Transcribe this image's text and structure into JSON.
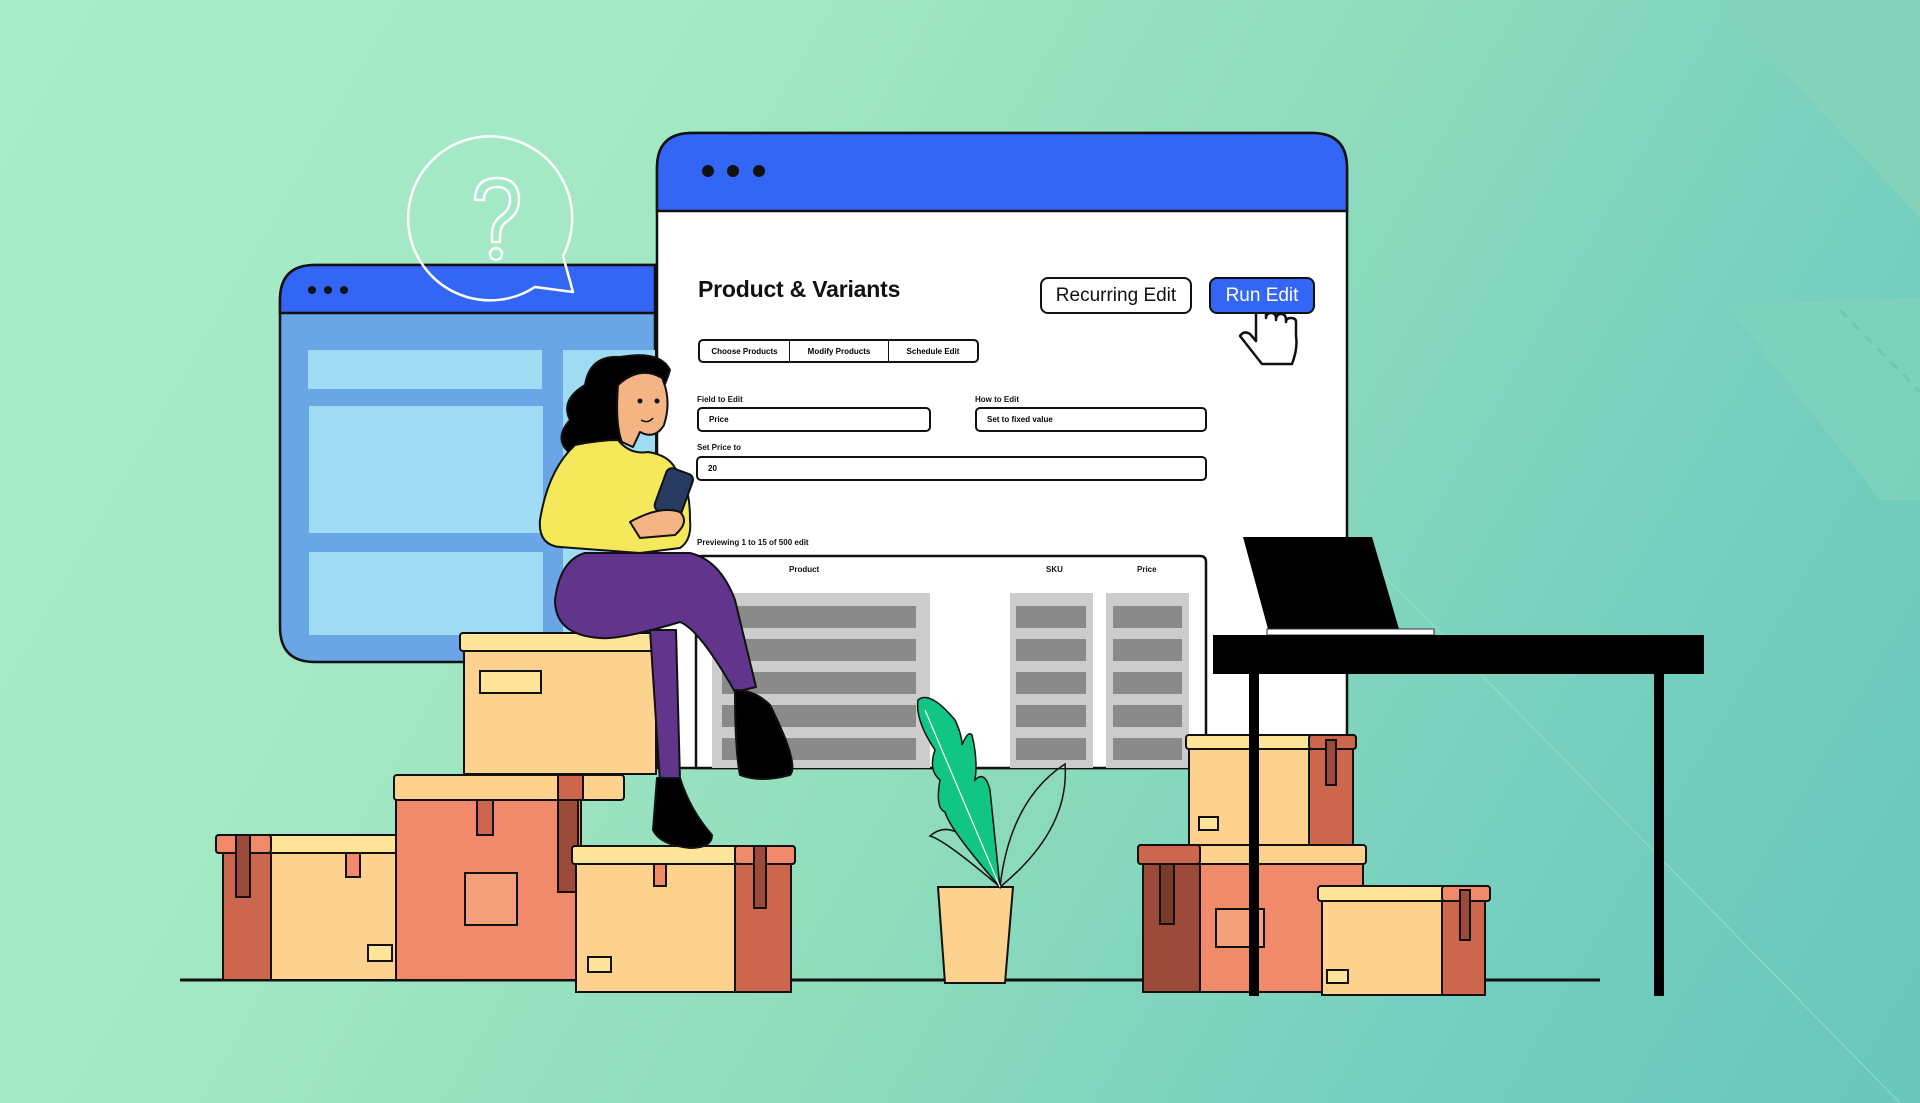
{
  "scene": {
    "description": "Illustration of a woman with a phone sitting on cardboard boxes in front of a bulk product editor window",
    "colors": {
      "accent_blue": "#3366f5",
      "left_window_body": "#6aa6e6",
      "left_window_panel": "#a0dbf4",
      "skeleton_light": "#cccccc",
      "skeleton_dark": "#8a8a8a",
      "box_light": "#fdd28e",
      "box_lid_light": "#fee59a",
      "box_coral": "#f08a6a",
      "box_brown": "#cc674e",
      "box_dark": "#9c4a3a",
      "plant_leaf": "#11c584",
      "pot": "#fdd28e",
      "sweater": "#f5e85a",
      "pants": "#62358c",
      "skin": "#f5b483"
    }
  },
  "background_window": {
    "dots": [
      "dot",
      "dot",
      "dot"
    ]
  },
  "speech_bubble": {
    "icon": "question-mark-icon",
    "text": "?"
  },
  "editor_window": {
    "dots": [
      "dot",
      "dot",
      "dot"
    ],
    "title": "Product & Variants",
    "buttons": {
      "recurring_edit": "Recurring Edit",
      "run_edit": "Run Edit"
    },
    "cursor_icon": "hand-pointer-icon",
    "tabs": [
      {
        "label": "Choose Products"
      },
      {
        "label": "Modify Products"
      },
      {
        "label": "Schedule Edit"
      }
    ],
    "form": {
      "field_to_edit": {
        "label": "Field to Edit",
        "value": "Price"
      },
      "how_to_edit": {
        "label": "How to Edit",
        "value": "Set to fixed value"
      },
      "set_price_to": {
        "label": "Set Price to",
        "value": "20"
      }
    },
    "preview": {
      "summary": "Previewing 1 to 15 of 500 edit",
      "columns": [
        "Product",
        "SKU",
        "Price"
      ],
      "placeholder_rows": 5
    }
  }
}
